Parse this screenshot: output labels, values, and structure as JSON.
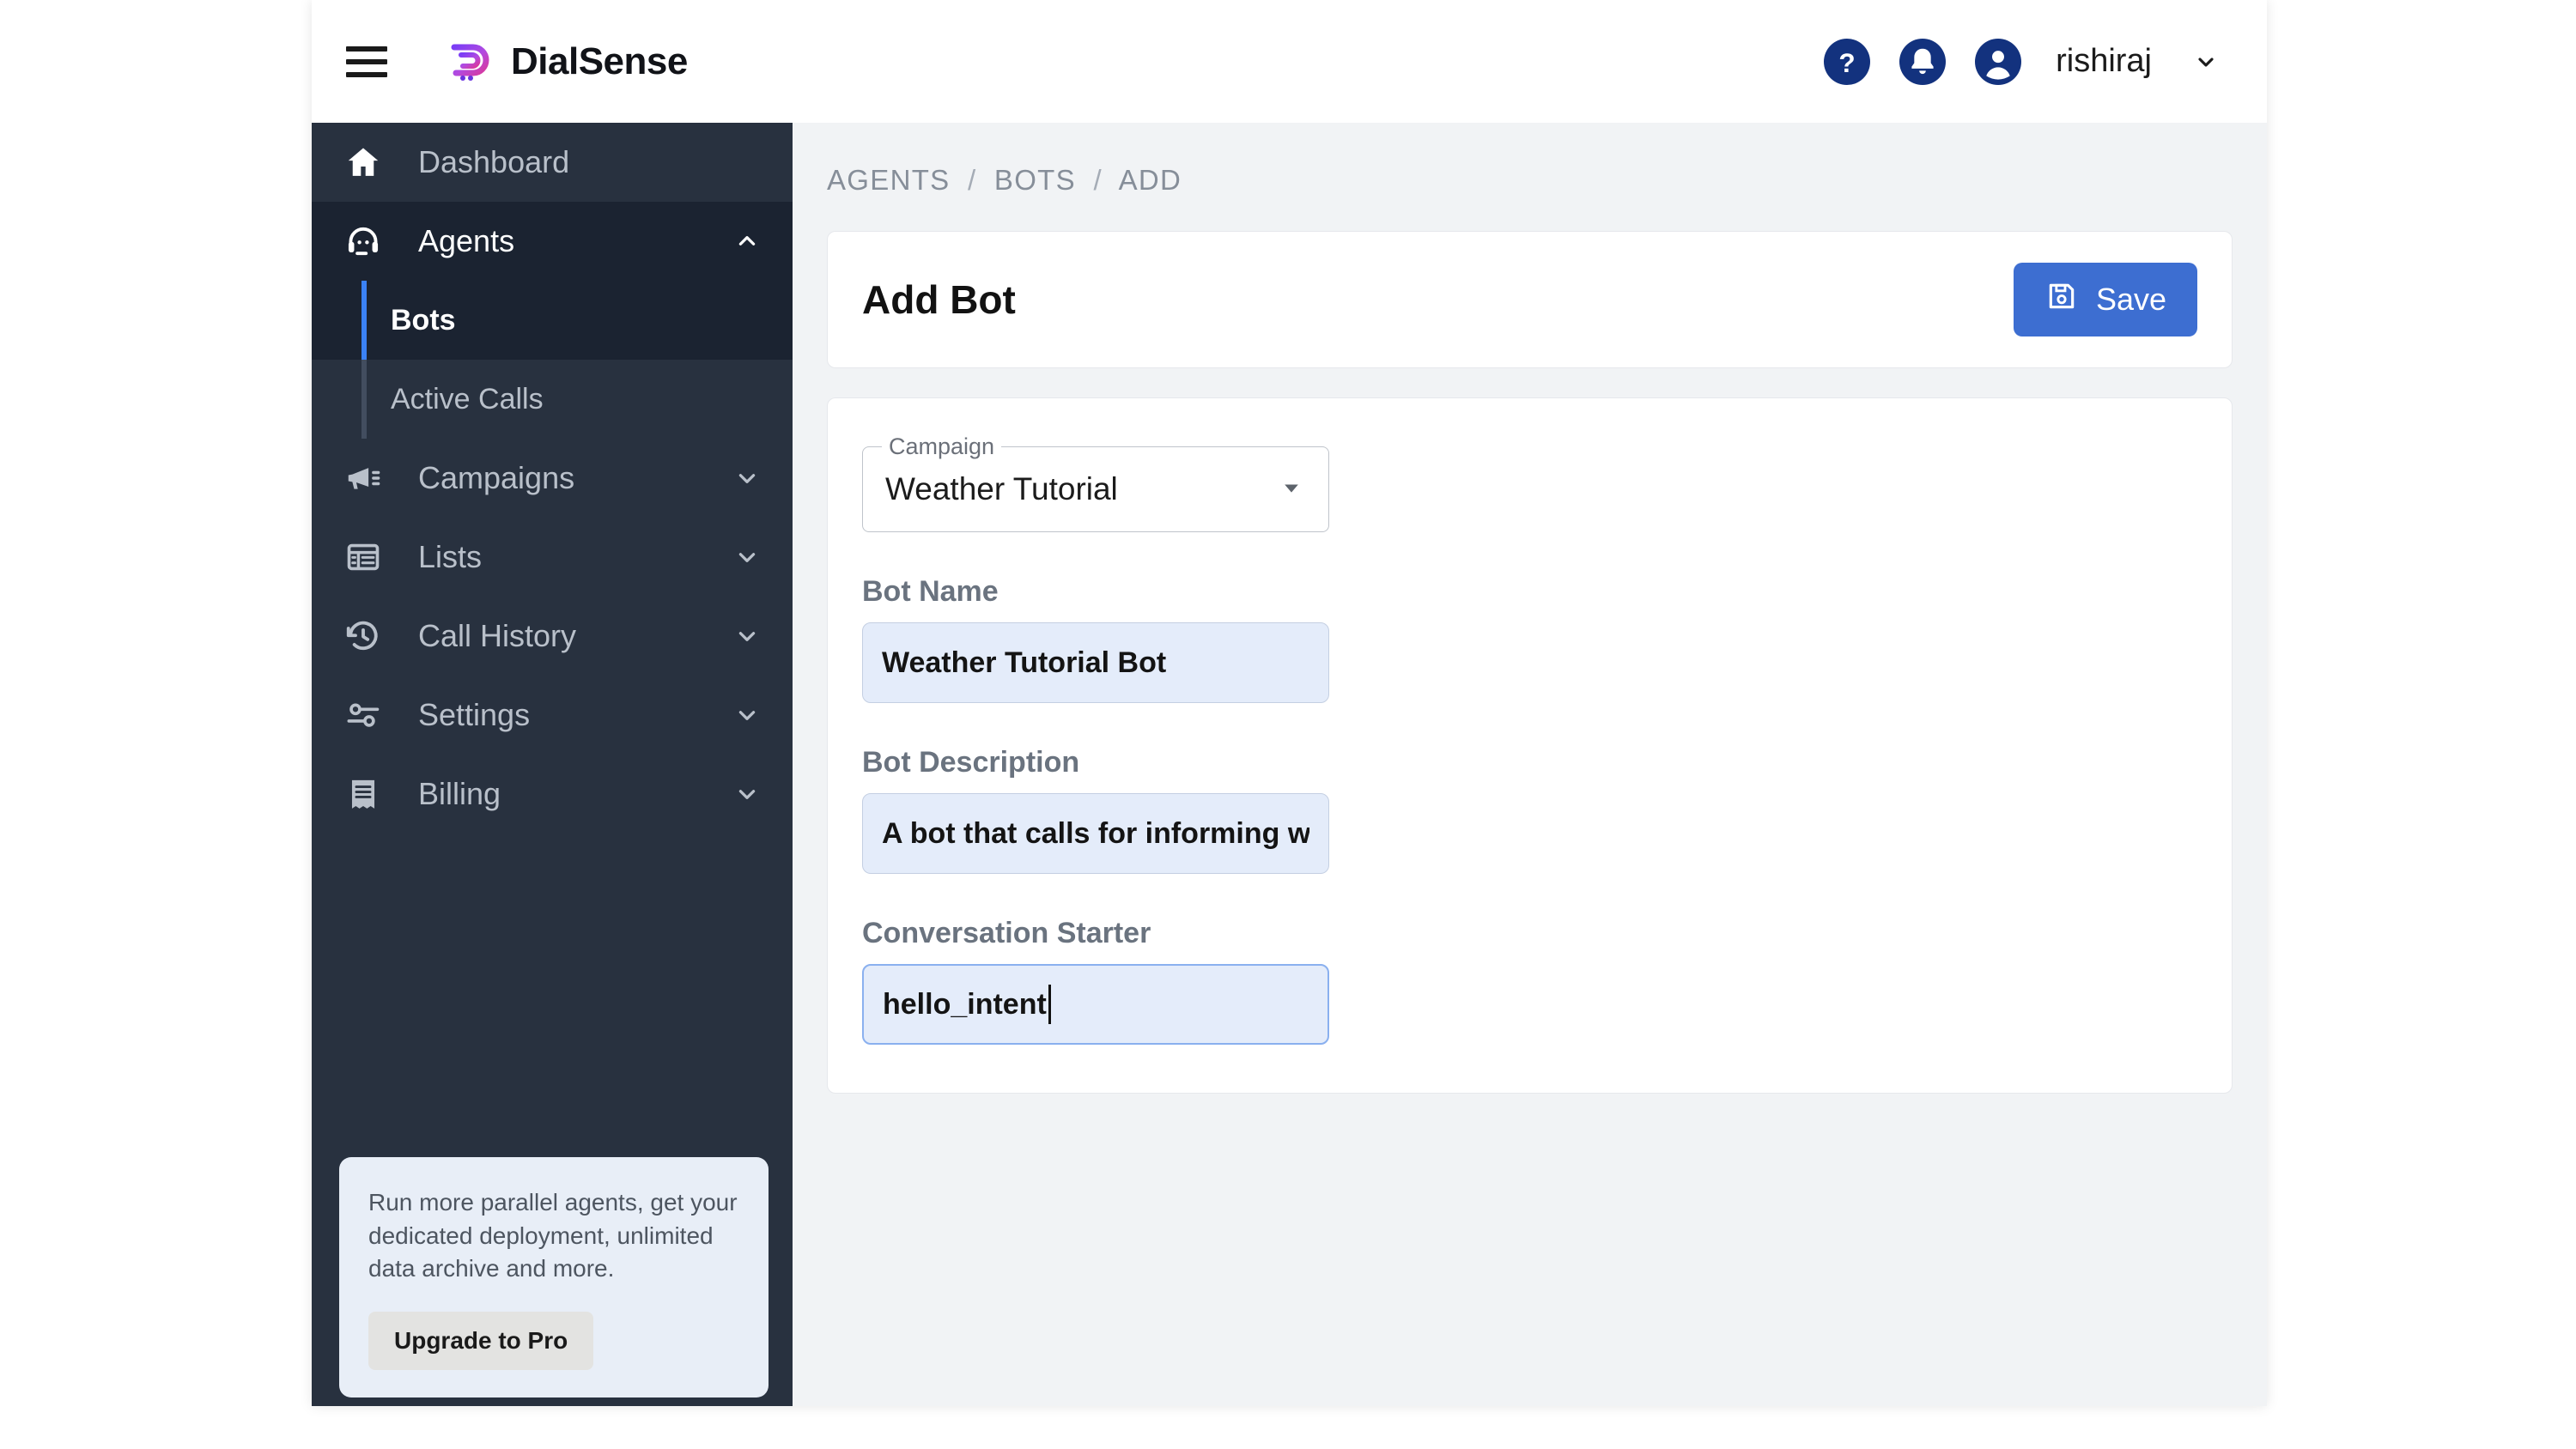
{
  "topbar": {
    "menu_icon": "hamburger-icon",
    "brand_name": "DialSense",
    "brand_logo_icon": "dialsense-logo-icon",
    "help_icon": "help-question-icon",
    "notifications_icon": "bell-icon",
    "avatar_icon": "user-avatar-icon",
    "username": "rishiraj",
    "caret_icon": "chevron-down-icon",
    "accent_circle_color": "#13327e"
  },
  "sidebar": {
    "background_color": "#28313f",
    "active_accent_color": "#3b82f6",
    "items": [
      {
        "label": "Dashboard",
        "icon": "home-icon",
        "expandable": false,
        "expanded": false
      },
      {
        "label": "Agents",
        "icon": "headset-agent-icon",
        "expandable": true,
        "expanded": true,
        "chevron": "chevron-up-icon"
      },
      {
        "label": "Campaigns",
        "icon": "megaphone-icon",
        "expandable": true,
        "expanded": false,
        "chevron": "chevron-down-icon"
      },
      {
        "label": "Lists",
        "icon": "table-list-icon",
        "expandable": true,
        "expanded": false,
        "chevron": "chevron-down-icon"
      },
      {
        "label": "Call History",
        "icon": "history-clock-icon",
        "expandable": true,
        "expanded": false,
        "chevron": "chevron-down-icon"
      },
      {
        "label": "Settings",
        "icon": "sliders-icon",
        "expandable": true,
        "expanded": false,
        "chevron": "chevron-down-icon"
      },
      {
        "label": "Billing",
        "icon": "receipt-icon",
        "expandable": true,
        "expanded": false,
        "chevron": "chevron-down-icon"
      }
    ],
    "submenu": [
      {
        "label": "Bots",
        "active": true
      },
      {
        "label": "Active Calls",
        "active": false
      }
    ],
    "upgrade_card": {
      "text": "Run more parallel agents, get your dedicated deployment, unlimited data archive and more.",
      "button_label": "Upgrade to Pro"
    }
  },
  "breadcrumb": {
    "items": [
      "AGENTS",
      "BOTS",
      "ADD"
    ],
    "separator": "/"
  },
  "page": {
    "title": "Add Bot",
    "save_label": "Save",
    "save_icon": "floppy-disk-save-icon",
    "save_button_color": "#3d6ed1"
  },
  "form": {
    "campaign": {
      "legend": "Campaign",
      "value": "Weather Tutorial",
      "caret_icon": "dropdown-triangle-icon"
    },
    "bot_name": {
      "label": "Bot Name",
      "value": "Weather Tutorial Bot",
      "placeholder": ""
    },
    "bot_description": {
      "label": "Bot Description",
      "value": "A bot that calls for informing w",
      "placeholder": ""
    },
    "conversation_starter": {
      "label": "Conversation Starter",
      "value": "hello_intent",
      "placeholder": "",
      "focused": true
    }
  }
}
